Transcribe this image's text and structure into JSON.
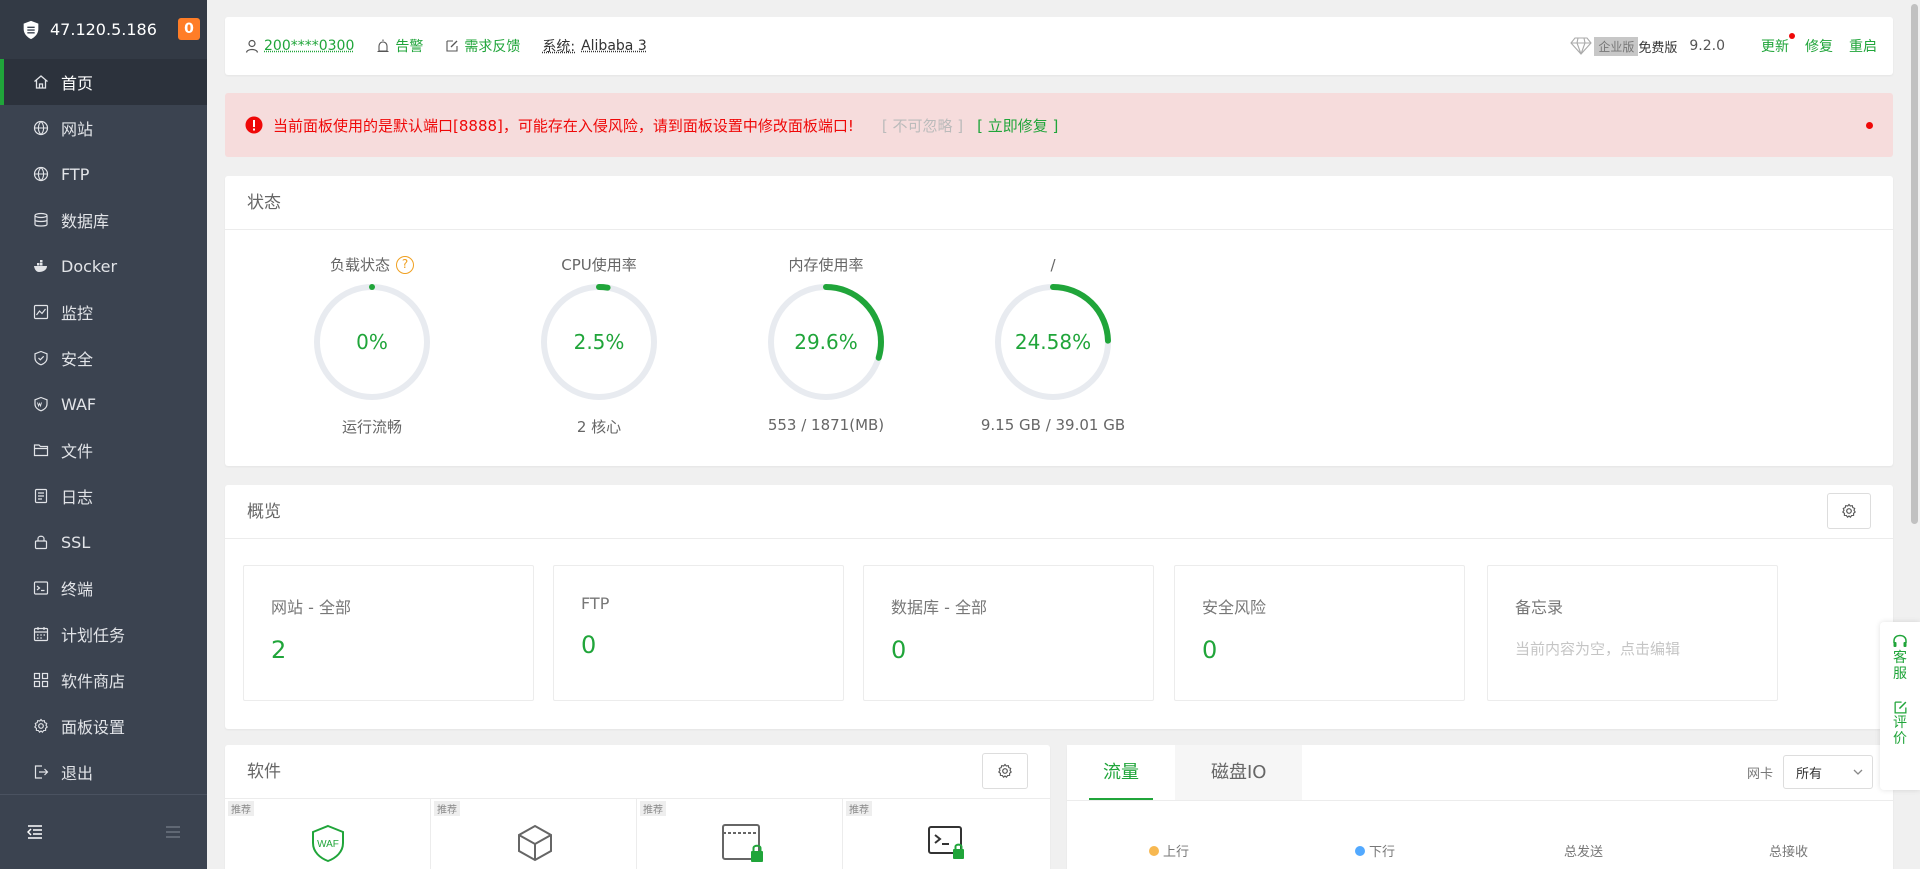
{
  "sidebar": {
    "ip": "47.120.5.186",
    "badge": "0",
    "items": [
      {
        "label": "首页",
        "icon": "home-icon"
      },
      {
        "label": "网站",
        "icon": "globe-icon"
      },
      {
        "label": "FTP",
        "icon": "ftp-icon"
      },
      {
        "label": "数据库",
        "icon": "database-icon"
      },
      {
        "label": "Docker",
        "icon": "docker-icon"
      },
      {
        "label": "监控",
        "icon": "monitor-icon"
      },
      {
        "label": "安全",
        "icon": "shield-icon"
      },
      {
        "label": "WAF",
        "icon": "waf-icon"
      },
      {
        "label": "文件",
        "icon": "folder-icon"
      },
      {
        "label": "日志",
        "icon": "log-icon"
      },
      {
        "label": "SSL",
        "icon": "ssl-icon"
      },
      {
        "label": "终端",
        "icon": "terminal-icon"
      },
      {
        "label": "计划任务",
        "icon": "calendar-icon"
      },
      {
        "label": "软件商店",
        "icon": "apps-icon"
      },
      {
        "label": "面板设置",
        "icon": "gear-icon"
      },
      {
        "label": "退出",
        "icon": "logout-icon"
      }
    ]
  },
  "topbar": {
    "user": "200****0300",
    "alert": "告警",
    "feedback": "需求反馈",
    "system": "系统:",
    "system_value": "Alibaba 3",
    "enterprise": "企业版",
    "free": "免费版",
    "version": "9.2.0",
    "update": "更新",
    "repair": "修复",
    "restart": "重启"
  },
  "warning": {
    "message": "当前面板使用的是默认端口[8888]，可能存在入侵风险，请到面板设置中修改面板端口!",
    "ignore": "[ 不可忽略 ]",
    "fix": "[ 立即修复 ]"
  },
  "status": {
    "title": "状态",
    "gauges": [
      {
        "title": "负载状态",
        "value": "0%",
        "percent": 0,
        "sub": "运行流畅"
      },
      {
        "title": "CPU使用率",
        "value": "2.5%",
        "percent": 2.5,
        "sub": "2 核心"
      },
      {
        "title": "内存使用率",
        "value": "29.6%",
        "percent": 29.6,
        "sub": "553 / 1871(MB)"
      },
      {
        "title": "/",
        "value": "24.58%",
        "percent": 24.58,
        "sub": "9.15 GB / 39.01 GB"
      }
    ]
  },
  "overview": {
    "title": "概览",
    "boxes": [
      {
        "label": "网站 - 全部",
        "value": "2"
      },
      {
        "label": "FTP",
        "value": "0"
      },
      {
        "label": "数据库 - 全部",
        "value": "0"
      },
      {
        "label": "安全风险",
        "value": "0"
      }
    ],
    "memo_label": "备忘录",
    "memo_text": "当前内容为空，点击编辑"
  },
  "software": {
    "title": "软件",
    "tiles": [
      {
        "tag": "推荐",
        "icon": "waf-icon",
        "icon_text": "WAF"
      },
      {
        "tag": "推荐",
        "icon": "cube-icon"
      },
      {
        "tag": "推荐",
        "icon": "browser-lock-icon"
      },
      {
        "tag": "推荐",
        "icon": "terminal-lock-icon"
      }
    ]
  },
  "traffic": {
    "tabs": [
      "流量",
      "磁盘IO"
    ],
    "nic_label": "网卡",
    "nic_value": "所有",
    "legend": [
      {
        "label": "上行",
        "color": "#f7b851"
      },
      {
        "label": "下行",
        "color": "#52a9ff"
      },
      {
        "label": "总发送"
      },
      {
        "label": "总接收"
      }
    ]
  },
  "float": {
    "service": [
      "客",
      "服"
    ],
    "review": [
      "评",
      "价"
    ]
  },
  "colors": {
    "accent": "#20a53a",
    "danger": "#ef0808",
    "sidebar": "#3b4350"
  }
}
